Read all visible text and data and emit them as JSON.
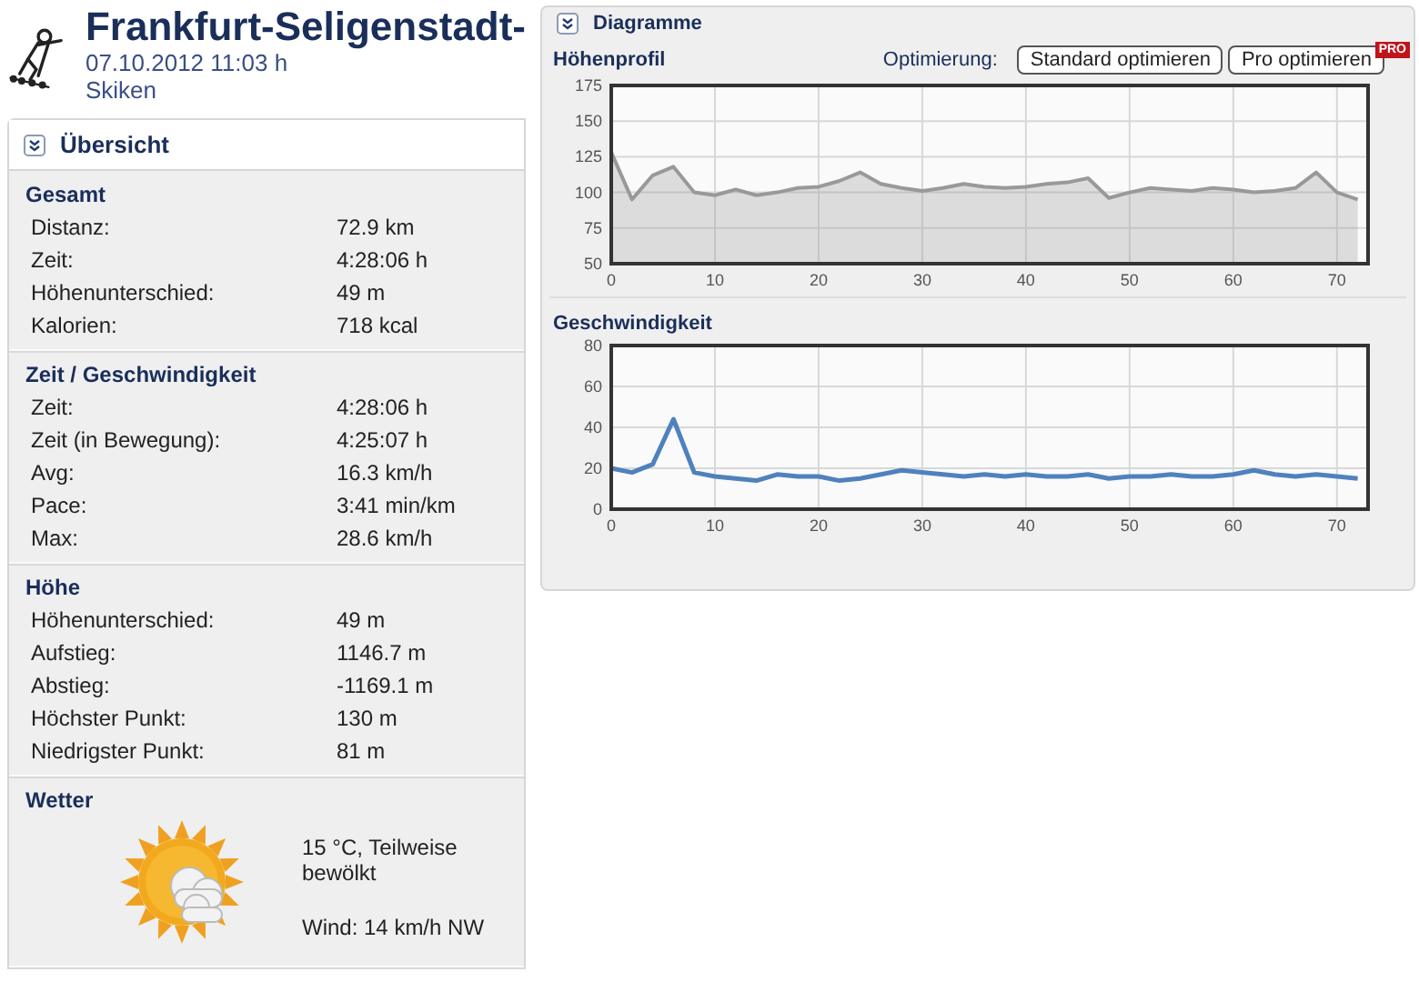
{
  "activity": {
    "title": "Frankfurt-Seligenstadt-",
    "datetime": "07.10.2012 11:03 h",
    "sport": "Skiken"
  },
  "overview": {
    "heading": "Übersicht",
    "sections": [
      {
        "title": "Gesamt",
        "rows": [
          {
            "label": "Distanz:",
            "value": "72.9 km"
          },
          {
            "label": "Zeit:",
            "value": "4:28:06 h"
          },
          {
            "label": "Höhenunterschied:",
            "value": "49 m"
          },
          {
            "label": "Kalorien:",
            "value": "718 kcal"
          }
        ]
      },
      {
        "title": "Zeit / Geschwindigkeit",
        "rows": [
          {
            "label": "Zeit:",
            "value": "4:28:06 h"
          },
          {
            "label": "Zeit (in Bewegung):",
            "value": "4:25:07 h"
          },
          {
            "label": "Avg:",
            "value": "16.3 km/h"
          },
          {
            "label": "Pace:",
            "value": "3:41 min/km"
          },
          {
            "label": "Max:",
            "value": "28.6 km/h"
          }
        ]
      },
      {
        "title": "Höhe",
        "rows": [
          {
            "label": "Höhenunterschied:",
            "value": "49 m"
          },
          {
            "label": "Aufstieg:",
            "value": "1146.7 m"
          },
          {
            "label": "Abstieg:",
            "value": "-1169.1 m"
          },
          {
            "label": "Höchster Punkt:",
            "value": "130 m"
          },
          {
            "label": "Niedrigster Punkt:",
            "value": "81 m"
          }
        ]
      }
    ],
    "weather": {
      "title": "Wetter",
      "condition": "15 °C, Teilweise bewölkt",
      "wind": "Wind: 14 km/h NW"
    }
  },
  "diagrams": {
    "heading": "Diagramme",
    "optimize_label": "Optimierung:",
    "buttons": [
      {
        "label": "Standard optimieren"
      },
      {
        "label": "Pro optimieren",
        "badge": "PRO"
      }
    ],
    "charts": [
      {
        "chart_data": {
          "type": "area",
          "title": "Höhenprofil",
          "x": [
            0,
            2,
            4,
            6,
            8,
            10,
            12,
            14,
            16,
            18,
            20,
            22,
            24,
            26,
            28,
            30,
            32,
            34,
            36,
            38,
            40,
            42,
            44,
            46,
            48,
            50,
            52,
            54,
            56,
            58,
            60,
            62,
            64,
            66,
            68,
            70,
            72
          ],
          "grid": true,
          "series": [
            {
              "color": "#999999",
              "values": [
                128,
                95,
                112,
                118,
                100,
                98,
                102,
                98,
                100,
                103,
                104,
                108,
                114,
                106,
                103,
                101,
                103,
                106,
                104,
                103,
                104,
                106,
                107,
                110,
                96,
                100,
                103,
                102,
                101,
                103,
                102,
                100,
                101,
                103,
                114,
                100,
                95
              ]
            }
          ],
          "xlim": [
            0,
            73
          ],
          "ylim": [
            50,
            175
          ],
          "xticks": [
            0,
            10,
            20,
            30,
            40,
            50,
            60,
            70
          ],
          "yticks": [
            50,
            75,
            100,
            125,
            150,
            175
          ]
        }
      },
      {
        "chart_data": {
          "type": "line",
          "title": "Geschwindigkeit",
          "x": [
            0,
            2,
            4,
            6,
            8,
            10,
            12,
            14,
            16,
            18,
            20,
            22,
            24,
            26,
            28,
            30,
            32,
            34,
            36,
            38,
            40,
            42,
            44,
            46,
            48,
            50,
            52,
            54,
            56,
            58,
            60,
            62,
            64,
            66,
            68,
            70,
            72
          ],
          "grid": true,
          "series": [
            {
              "color": "#4f81bd",
              "values": [
                20,
                18,
                22,
                44,
                18,
                16,
                15,
                14,
                17,
                16,
                16,
                14,
                15,
                17,
                19,
                18,
                17,
                16,
                17,
                16,
                17,
                16,
                16,
                17,
                15,
                16,
                16,
                17,
                16,
                16,
                17,
                19,
                17,
                16,
                17,
                16,
                15
              ]
            }
          ],
          "xlim": [
            0,
            73
          ],
          "ylim": [
            0,
            80
          ],
          "xticks": [
            0,
            10,
            20,
            30,
            40,
            50,
            60,
            70
          ],
          "yticks": [
            0,
            20,
            40,
            60,
            80
          ]
        }
      }
    ]
  }
}
